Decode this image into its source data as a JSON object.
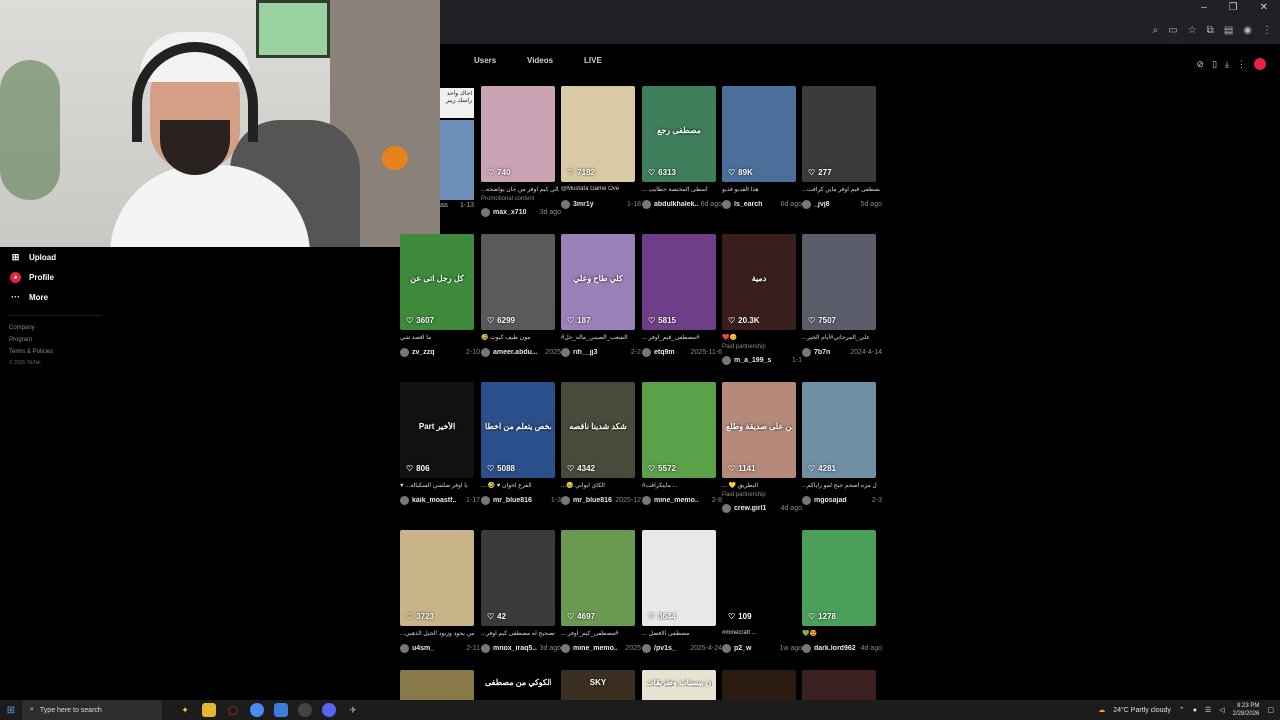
{
  "browser": {
    "window_controls": [
      "–",
      "❐",
      "✕"
    ]
  },
  "tabs": [
    {
      "label": "Users"
    },
    {
      "label": "Videos"
    },
    {
      "label": "LIVE"
    }
  ],
  "nav": {
    "items": [
      {
        "label": "Upload",
        "icon": "plus-icon"
      },
      {
        "label": "Profile",
        "icon": "profile-icon"
      },
      {
        "label": "More",
        "icon": "more-icon"
      }
    ],
    "links": [
      "Company",
      "Program",
      "Terms & Policies"
    ],
    "copyright": "© 2026 TikTok"
  },
  "side_strip": {
    "note": "اجاك واحد راسك زيبر",
    "user_fragment": "aa",
    "date": "1-13"
  },
  "videos": [
    {
      "views": "740",
      "caption": "...يالي كيم اوفر من جان يواضحه",
      "tag": "Promotional content",
      "user": "max_x710",
      "date": "3d ago",
      "overlay": "",
      "bg": "#c9a3b3"
    },
    {
      "views": "7182",
      "caption": "@Mustafa Game Ove",
      "tag": "",
      "user": "3mr1y",
      "date": "1-18",
      "overlay": "",
      "bg": "#d9c9a4"
    },
    {
      "views": "6313",
      "caption": "... أسطى المختصة حطايب",
      "tag": "",
      "user": "abdulkhalek...",
      "date": "6d ago",
      "overlay": "مصطفى رجع",
      "bg": "#3f7e5a"
    },
    {
      "views": "89K",
      "caption": "هذا الفديو فديو",
      "tag": "",
      "user": "ls_earch",
      "date": "6d ago",
      "overlay": "",
      "bg": "#4a6f9a"
    },
    {
      "views": "277",
      "caption": "...مصطفى قيم اوفر ماين كرافت",
      "tag": "",
      "user": "_jvj8",
      "date": "5d ago",
      "overlay": "",
      "bg": "#3b3b3b"
    },
    {
      "views": "3607",
      "caption": "ما اقصد شي",
      "tag": "",
      "user": "zv_zzq",
      "date": "2-10",
      "overlay": "كل رجل اتى عن",
      "bg": "#3d8a3b"
    },
    {
      "views": "6299",
      "caption": "🤣 مون طيف كيوت",
      "tag": "",
      "user": "ameer.abdu...",
      "date": "2025",
      "overlay": "",
      "bg": "#5a5a5a"
    },
    {
      "views": "187",
      "caption": "#الشعب_الصيني_ماله_حل",
      "tag": "",
      "user": "rih__jj3",
      "date": "2-2",
      "overlay": "كلي طاح وعلي",
      "bg": "#9a7fb8"
    },
    {
      "views": "5815",
      "caption": "... مصطفى_قيم_اوفر#",
      "tag": "",
      "user": "etq9m",
      "date": "2025-11-6",
      "overlay": "",
      "bg": "#6e3f88"
    },
    {
      "views": "20.3K",
      "caption": "❤️😊",
      "tag": "Paid partnership",
      "user": "m_a_199_s",
      "date": "1-1",
      "overlay": "دمية",
      "bg": "#3a1e1e"
    },
    {
      "views": "7507",
      "caption": "...علي_المرجاني#أيام الخير",
      "tag": "",
      "user": "7b7n",
      "date": "2024-4-14",
      "overlay": "",
      "bg": "#5a5c6a"
    },
    {
      "views": "806",
      "caption": "♥ ...يا اوفر صلسي السكياله",
      "tag": "",
      "user": "kaik_moastf...",
      "date": "1-17",
      "overlay": "Part الأخير",
      "bg": "#111111"
    },
    {
      "views": "5088",
      "caption": "... 🤣 ♥ الفزع اخوان",
      "tag": "",
      "user": "mr_blue816",
      "date": "1-3",
      "overlay": "شخص يتعلم من اخطا",
      "bg": "#2b4f8a"
    },
    {
      "views": "4342",
      "caption": "...🥹 الكاي ايواني",
      "tag": "",
      "user": "mr_blue816",
      "date": "2025-12",
      "overlay": "شكد شدينا ناقصه",
      "bg": "#4a4a3a"
    },
    {
      "views": "5572",
      "caption": "#ماينكرافت ...",
      "tag": "",
      "user": "mine_memo...",
      "date": "2-8",
      "overlay": "",
      "bg": "#5aa14a"
    },
    {
      "views": "1141",
      "caption": "... 💛 البطريق",
      "tag": "Paid partnership",
      "user": "crew.girl1",
      "date": "4d ago",
      "overlay": "من على صديقة وطلع",
      "bg": "#b58a7a"
    },
    {
      "views": "4281",
      "caption": "...ل مزه اصحم جبح لمو راياكم",
      "tag": "",
      "user": "mgosajad",
      "date": "2-3",
      "overlay": "",
      "bg": "#6f8fa5"
    },
    {
      "views": "3723",
      "caption": "...من يحود وزبود الحيل الذهبي",
      "tag": "",
      "user": "u4sm_",
      "date": "2-11",
      "overlay": "",
      "bg": "#c9b48a"
    },
    {
      "views": "42",
      "caption": "...تصحيح له مصطفى كيم اوفر",
      "tag": "",
      "user": "mnox_iraq5...",
      "date": "3d ago",
      "overlay": "",
      "bg": "#3a3a3a"
    },
    {
      "views": "4697",
      "caption": "... مصطفى_كيم_اوفر#",
      "tag": "",
      "user": "mine_memo...",
      "date": "2025",
      "overlay": "",
      "bg": "#6a9a4f"
    },
    {
      "views": "3644",
      "caption": "... مصطفى الافضل",
      "tag": "",
      "user": "/pv1s_",
      "date": "2025-4-24",
      "overlay": "",
      "bg": "#e8e8e8"
    },
    {
      "views": "109",
      "caption": "#minecraft ...",
      "tag": "",
      "user": "p2_w",
      "date": "1w ago",
      "overlay": "",
      "bg": "#000000"
    },
    {
      "views": "1278",
      "caption": "💚😍",
      "tag": "",
      "user": "dark.lord962",
      "date": "4d ago",
      "overlay": "",
      "bg": "#4aa05a"
    },
    {
      "views": "",
      "caption": "",
      "tag": "",
      "user": "",
      "date": "",
      "overlay": "",
      "bg": "#8a7a4a"
    },
    {
      "views": "",
      "caption": "",
      "tag": "",
      "user": "",
      "date": "",
      "overlay": "لحظة فلتم الكوكي من مصطفى",
      "bg": "#000000"
    },
    {
      "views": "",
      "caption": "",
      "tag": "",
      "user": "",
      "date": "",
      "overlay": "SKY",
      "bg": "#3a2f20"
    },
    {
      "views": "",
      "caption": "",
      "tag": "",
      "user": "",
      "date": "",
      "overlay": "ربه يطلبون بيسيات وطريقات",
      "bg": "#e8e2d0"
    },
    {
      "views": "",
      "caption": "",
      "tag": "",
      "user": "",
      "date": "",
      "overlay": "",
      "bg": "#2a1a10"
    },
    {
      "views": "",
      "caption": "",
      "tag": "",
      "user": "",
      "date": "",
      "overlay": "",
      "bg": "#3a2020"
    }
  ],
  "taskbar": {
    "search_placeholder": "Type here to search",
    "weather": "24°C  Partly cloudy",
    "time": "8:23 PM",
    "date": "2/28/2026"
  }
}
